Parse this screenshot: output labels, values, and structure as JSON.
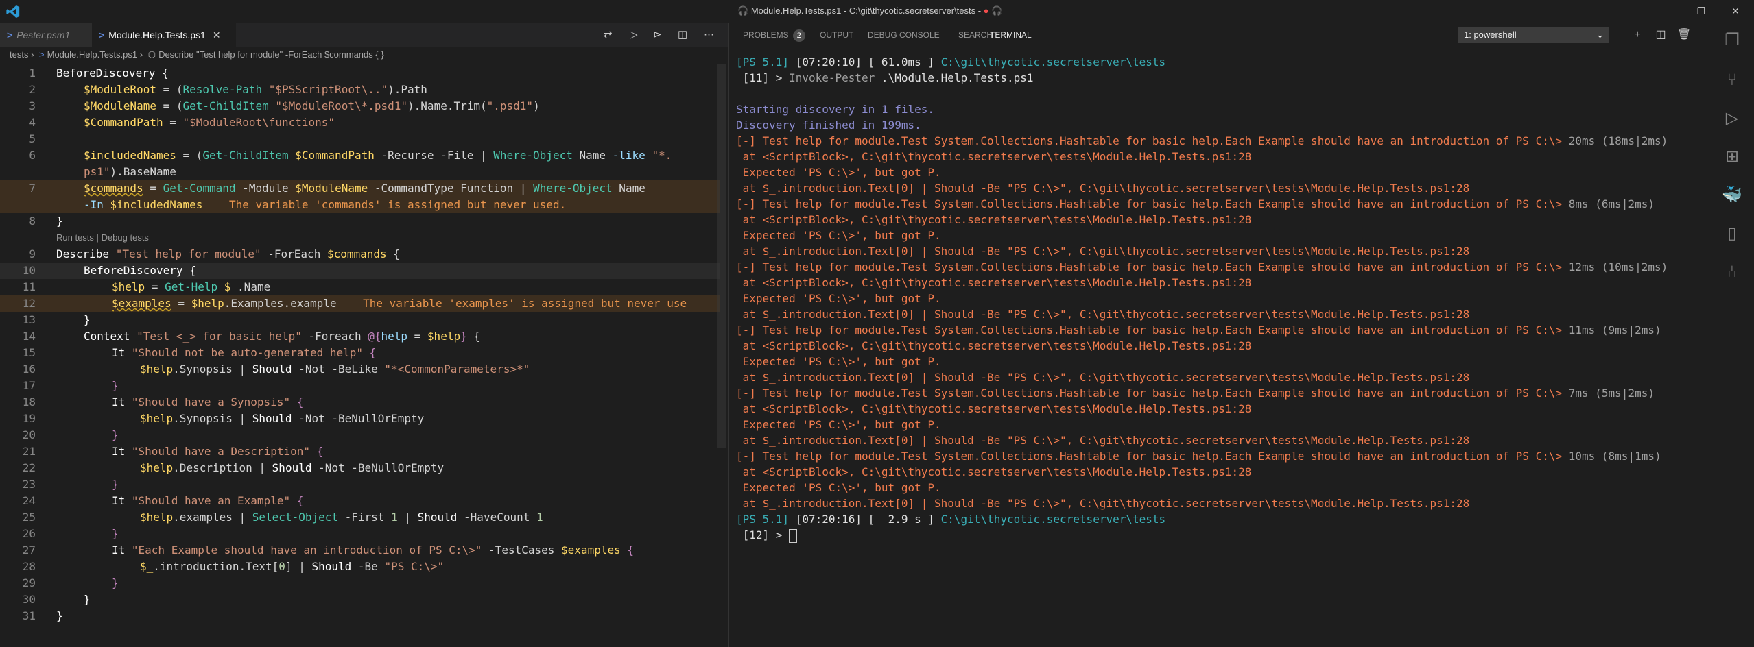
{
  "titlebar": {
    "title": "Module.Help.Tests.ps1 - C:\\git\\thycotic.secretserver\\tests - "
  },
  "tabs": [
    {
      "label": "Pester.psm1"
    },
    {
      "label": "Module.Help.Tests.ps1"
    }
  ],
  "breadcrumbs": {
    "folder": "tests",
    "file": "Module.Help.Tests.ps1",
    "symbol": "Describe \"Test help for module\" -ForEach $commands { }"
  },
  "codelens": {
    "run": "Run tests",
    "separator": "|",
    "debug": "Debug tests"
  },
  "code": {
    "line_numbers": [
      "1",
      "2",
      "3",
      "4",
      "5",
      "6",
      "",
      "7",
      "",
      "8",
      "9",
      "10",
      "11",
      "12",
      "13",
      "14",
      "15",
      "16",
      "17",
      "18",
      "19",
      "20",
      "21",
      "22",
      "23",
      "24",
      "25",
      "26",
      "27",
      "28",
      "29",
      "30",
      "31"
    ],
    "l1": "BeforeDiscovery {",
    "l2a": "$ModuleRoot",
    "l2b": " = (",
    "l2c": "Resolve-Path",
    "l2d": " \"$PSScriptRoot\\..\"",
    "l2e": ").Path",
    "l3a": "$ModuleName",
    "l3b": " = (",
    "l3c": "Get-ChildItem",
    "l3d": " \"$ModuleRoot\\*.psd1\"",
    "l3e": ").Name.Trim(",
    "l3f": "\".psd1\"",
    "l3g": ")",
    "l4a": "$CommandPath",
    "l4b": " = ",
    "l4c": "\"$ModuleRoot\\functions\"",
    "l6a": "$includedNames",
    "l6b": " = (",
    "l6c": "Get-ChildItem",
    "l6d": " $CommandPath",
    "l6e": " -Recurse -File | ",
    "l6f": "Where-Object",
    "l6g": " Name ",
    "l6h": "-like",
    "l6i": " \"*.",
    "l6j": "ps1\"",
    "l6k": ").BaseName",
    "l7a": "$commands",
    "l7b": " = ",
    "l7c": "Get-Command",
    "l7d": " -Module ",
    "l7e": "$ModuleName",
    "l7f": " -CommandType Function | ",
    "l7g": "Where-Object",
    "l7h": " Name",
    "l7i": "-In",
    "l7j": " $includedNames",
    "l7warn": "    The variable 'commands' is assigned but never used.",
    "l8": "}",
    "l9a": "Describe",
    "l9b": " \"Test help for module\"",
    "l9c": " -ForEach ",
    "l9d": "$commands",
    "l9e": " {",
    "l10": "BeforeDiscovery {",
    "l11a": "$help",
    "l11b": " = ",
    "l11c": "Get-Help",
    "l11d": " $_",
    "l11e": ".Name",
    "l12a": "$examples",
    "l12b": " = ",
    "l12c": "$help",
    "l12d": ".Examples.example",
    "l12warn": "    The variable 'examples' is assigned but never use",
    "l13": "}",
    "l14a": "Context",
    "l14b": " \"Test <_> for basic help\"",
    "l14c": " -Foreach ",
    "l14d": "@{",
    "l14e": "help",
    "l14f": " = ",
    "l14g": "$help",
    "l14h": "}",
    "l14i": " {",
    "l15a": "It",
    "l15b": " \"Should not be auto-generated help\"",
    "l15c": " {",
    "l16a": "$help",
    "l16b": ".Synopsis | ",
    "l16c": "Should",
    "l16d": " -Not -BeLike ",
    "l16e": "\"*<CommonParameters>*\"",
    "l17": "}",
    "l18a": "It",
    "l18b": " \"Should have a Synopsis\"",
    "l18c": " {",
    "l19a": "$help",
    "l19b": ".Synopsis | ",
    "l19c": "Should",
    "l19d": " -Not -BeNullOrEmpty",
    "l20": "}",
    "l21a": "It",
    "l21b": " \"Should have a Description\"",
    "l21c": " {",
    "l22a": "$help",
    "l22b": ".Description | ",
    "l22c": "Should",
    "l22d": " -Not -BeNullOrEmpty",
    "l23": "}",
    "l24a": "It",
    "l24b": " \"Should have an Example\"",
    "l24c": " {",
    "l25a": "$help",
    "l25b": ".examples | ",
    "l25c": "Select-Object",
    "l25d": " -First ",
    "l25e": "1",
    "l25f": " | ",
    "l25g": "Should",
    "l25h": " -HaveCount ",
    "l25i": "1",
    "l26": "}",
    "l27a": "It",
    "l27b": " \"Each Example should have an introduction of PS C:\\>\"",
    "l27c": " -TestCases ",
    "l27d": "$examples",
    "l27e": " {",
    "l28a": "$_",
    "l28b": ".introduction.Text[",
    "l28c": "0",
    "l28d": "] | ",
    "l28e": "Should",
    "l28f": " -Be ",
    "l28g": "\"PS C:\\>\"",
    "l29": "}",
    "l30": "}",
    "l31": "}"
  },
  "panel": {
    "tabs": {
      "problems": "PROBLEMS",
      "problems_count": "2",
      "output": "OUTPUT",
      "debug_console": "DEBUG CONSOLE",
      "search": "SEARCH",
      "terminal": "TERMINAL"
    },
    "terminal_select": "1: powershell"
  },
  "terminal": {
    "prompt1a": "[PS 5.1]",
    "prompt1b": " [07:20:10]",
    "prompt1c": " [ 61.0ms ]",
    "prompt1d": " C:\\git\\thycotic.secretserver\\tests",
    "cmd_num": " [11] > ",
    "cmd_a": "Invoke-Pester",
    "cmd_b": " .\\Module.Help.Tests.ps1",
    "disc1": "Starting discovery in 1 files.",
    "disc2": "Discovery finished in 199ms.",
    "fail_prefix": "[-] Test help for module.Test System.Collections.Hashtable for basic help.Each Example should have an introduction of PS C:\\>",
    "fails": [
      {
        "time": " 20ms (18ms|2ms)"
      },
      {
        "time": " 8ms (6ms|2ms)"
      },
      {
        "time": " 12ms (10ms|2ms)"
      },
      {
        "time": " 11ms (9ms|2ms)"
      },
      {
        "time": " 7ms (5ms|2ms)"
      },
      {
        "time": " 10ms (8ms|1ms)"
      }
    ],
    "at_block": " at <ScriptBlock>, C:\\git\\thycotic.secretserver\\tests\\Module.Help.Tests.ps1:28",
    "expected": " Expected 'PS C:\\>', but got P.",
    "at_line": " at $_.introduction.Text[0] | Should -Be \"PS C:\\>\", C:\\git\\thycotic.secretserver\\tests\\Module.Help.Tests.ps1:28",
    "prompt2a": "[PS 5.1]",
    "prompt2b": " [07:20:16]",
    "prompt2c": " [  2.9 s ]",
    "prompt2d": " C:\\git\\thycotic.secretserver\\tests",
    "cmd2_num": " [12] > "
  }
}
